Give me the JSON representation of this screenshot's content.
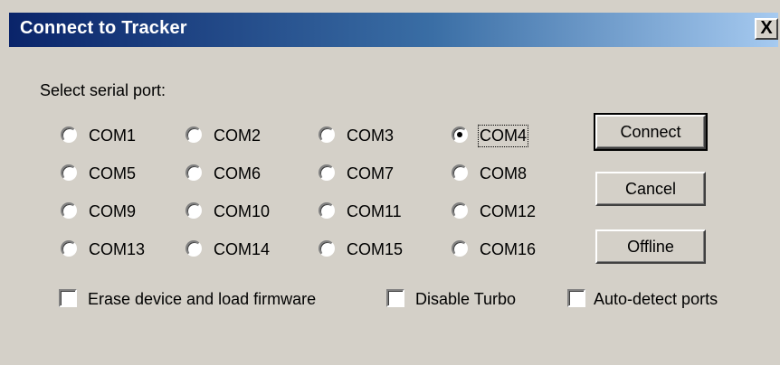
{
  "dialog": {
    "title": "Connect to Tracker",
    "close_label": "X",
    "prompt": "Select serial port:"
  },
  "ports": [
    {
      "label": "COM1",
      "selected": false
    },
    {
      "label": "COM2",
      "selected": false
    },
    {
      "label": "COM3",
      "selected": false
    },
    {
      "label": "COM4",
      "selected": true
    },
    {
      "label": "COM5",
      "selected": false
    },
    {
      "label": "COM6",
      "selected": false
    },
    {
      "label": "COM7",
      "selected": false
    },
    {
      "label": "COM8",
      "selected": false
    },
    {
      "label": "COM9",
      "selected": false
    },
    {
      "label": "COM10",
      "selected": false
    },
    {
      "label": "COM11",
      "selected": false
    },
    {
      "label": "COM12",
      "selected": false
    },
    {
      "label": "COM13",
      "selected": false
    },
    {
      "label": "COM14",
      "selected": false
    },
    {
      "label": "COM15",
      "selected": false
    },
    {
      "label": "COM16",
      "selected": false
    }
  ],
  "buttons": {
    "connect": "Connect",
    "cancel": "Cancel",
    "offline": "Offline"
  },
  "options": {
    "erase": {
      "label": "Erase device and load firmware",
      "checked": false
    },
    "turbo": {
      "label": "Disable Turbo",
      "checked": false
    },
    "autodetect": {
      "label": "Auto-detect ports",
      "checked": false
    }
  }
}
